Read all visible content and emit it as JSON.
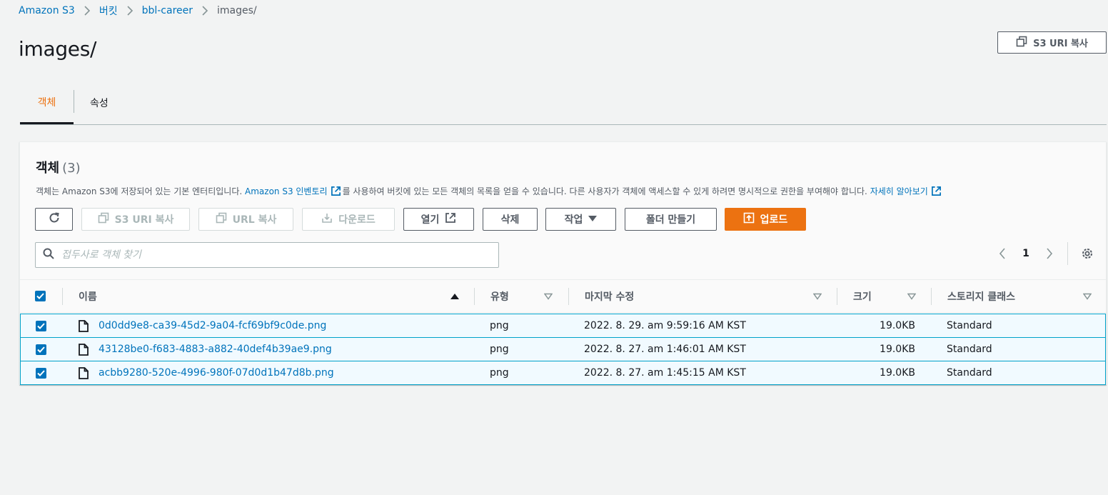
{
  "breadcrumb": {
    "items": [
      "Amazon S3",
      "버킷",
      "bbl-career"
    ],
    "current": "images/"
  },
  "page": {
    "title": "images/",
    "copy_uri_label": "S3 URI 복사"
  },
  "tabs": [
    "객체",
    "속성"
  ],
  "panel": {
    "title": "객체",
    "count": "(3)",
    "desc_pre": "객체는 Amazon S3에 저장되어 있는 기본 엔터티입니다.",
    "desc_link": "Amazon S3 인벤토리",
    "desc_mid": "를 사용하여 버킷에 있는 모든 객체의 목록을 얻을 수 있습니다. 다른 사용자가 객체에 액세스할 수 있게 하려면 명시적으로 권한을 부여해야 합니다.",
    "desc_more": "자세히 알아보기"
  },
  "toolbar": {
    "copy_s3_uri": "S3 URI 복사",
    "copy_url": "URL 복사",
    "download": "다운로드",
    "open": "열기",
    "delete": "삭제",
    "actions": "작업",
    "create_folder": "폴더 만들기",
    "upload": "업로드"
  },
  "search": {
    "placeholder": "접두사로 객체 찾기",
    "value": ""
  },
  "pagination": {
    "current_page": "1"
  },
  "table": {
    "columns": [
      "이름",
      "유형",
      "마지막 수정",
      "크기",
      "스토리지 클래스"
    ],
    "rows": [
      {
        "name": "0d0dd9e8-ca39-45d2-9a04-fcf69bf9c0de.png",
        "type": "png",
        "modified": "2022. 8. 29. am 9:59:16 AM KST",
        "size": "19.0KB",
        "storage": "Standard"
      },
      {
        "name": "43128be0-f683-4883-a882-40def4b39ae9.png",
        "type": "png",
        "modified": "2022. 8. 27. am 1:46:01 AM KST",
        "size": "19.0KB",
        "storage": "Standard"
      },
      {
        "name": "acbb9280-520e-4996-980f-07d0d1b47d8b.png",
        "type": "png",
        "modified": "2022. 8. 27. am 1:45:15 AM KST",
        "size": "19.0KB",
        "storage": "Standard"
      }
    ]
  },
  "colors": {
    "accent": "#ec7211",
    "link": "#0073bb",
    "selected_row_bg": "#f1faff",
    "selected_row_border": "#00a1c9"
  },
  "icons": [
    "chevron-right-icon",
    "copy-icon",
    "refresh-icon",
    "download-icon",
    "external-link-icon",
    "caret-down-icon",
    "upload-icon",
    "search-icon",
    "chevron-left-icon",
    "gear-icon",
    "sort-ascending-icon",
    "sort-icon",
    "file-icon",
    "checkbox-checked-icon"
  ]
}
